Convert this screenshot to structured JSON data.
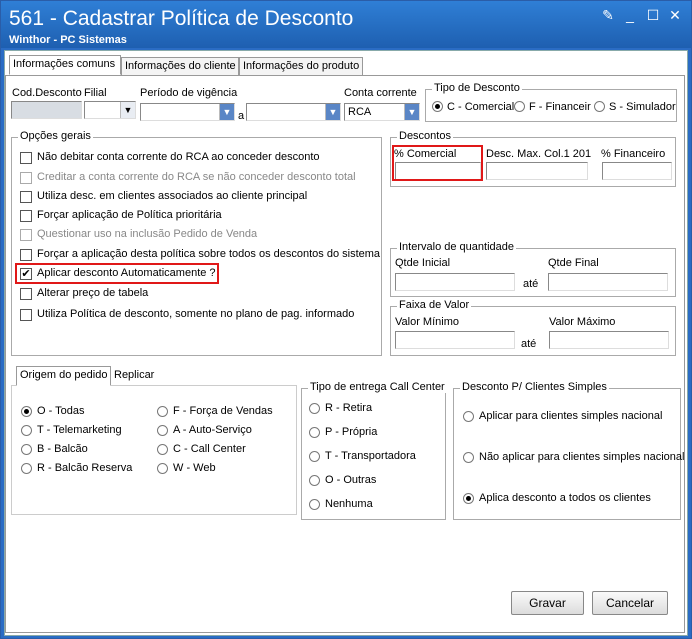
{
  "window": {
    "title": "561 - Cadastrar Política de Desconto",
    "subtitle": "Winthor - PC Sistemas"
  },
  "tabs": [
    "Informações comuns",
    "Informações do cliente",
    "Informações do produto"
  ],
  "fields": {
    "cod_desconto": "Cod.Desconto",
    "filial": "Filial",
    "periodo": "Período de vigência",
    "a": "a",
    "conta_corrente": "Conta corrente",
    "conta_corrente_value": "RCA"
  },
  "tipo_desconto": {
    "title": "Tipo de Desconto",
    "options": [
      "C - Comercial",
      "F - Financeiro",
      "S - Simulador"
    ],
    "selected": 0
  },
  "opcoes_gerais": {
    "title": "Opções gerais",
    "items": [
      {
        "label": "Não debitar conta corrente do RCA ao conceder desconto",
        "checked": false,
        "disabled": false
      },
      {
        "label": "Creditar a conta corrente do RCA se não conceder desconto total",
        "checked": false,
        "disabled": true
      },
      {
        "label": "Utiliza desc. em clientes associados ao cliente principal",
        "checked": false,
        "disabled": false
      },
      {
        "label": "Forçar aplicação de Política prioritária",
        "checked": false,
        "disabled": false
      },
      {
        "label": "Questionar uso na inclusão Pedido de Venda",
        "checked": false,
        "disabled": true
      },
      {
        "label": "Forçar a aplicação desta política sobre todos os descontos do sistema",
        "checked": false,
        "disabled": false
      },
      {
        "label": "Aplicar desconto Automaticamente ?",
        "checked": true,
        "disabled": false
      },
      {
        "label": "Alterar preço de tabela",
        "checked": false,
        "disabled": false
      },
      {
        "label": "Utiliza Política de desconto, somente no plano de pag. informado",
        "checked": false,
        "disabled": false
      }
    ]
  },
  "descontos": {
    "title": "Descontos",
    "comercial": "% Comercial",
    "desc_max": "Desc. Max. Col.1 201",
    "financeiro": "% Financeiro"
  },
  "intervalo": {
    "title": "Intervalo de quantidade",
    "inicial": "Qtde Inicial",
    "final": "Qtde Final",
    "ate": "até"
  },
  "faixa": {
    "title": "Faixa de Valor",
    "minimo": "Valor Mínimo",
    "maximo": "Valor Máximo",
    "ate": "até"
  },
  "subtabs": [
    "Origem do pedido",
    "Replicar"
  ],
  "origem": {
    "left": [
      "O - Todas",
      "T - Telemarketing",
      "B - Balcão",
      "R - Balcão Reserva"
    ],
    "right": [
      "F - Força de Vendas",
      "A - Auto-Serviço",
      "C - Call Center",
      "W - Web"
    ],
    "selected": "O - Todas"
  },
  "entrega": {
    "title": "Tipo de entrega Call Center",
    "options": [
      "R - Retira",
      "P - Própria",
      "T - Transportadora",
      "O - Outras",
      "Nenhuma"
    ]
  },
  "simples": {
    "title": "Desconto P/ Clientes Simples",
    "options": [
      "Aplicar para clientes simples nacional",
      "Não aplicar para clientes simples nacional",
      "Aplica desconto a todos os clientes"
    ],
    "selected": 2
  },
  "buttons": {
    "gravar": "Gravar",
    "cancelar": "Cancelar"
  }
}
